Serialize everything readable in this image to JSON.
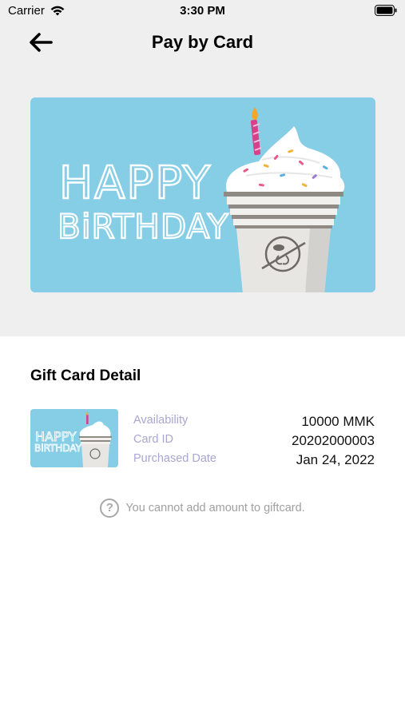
{
  "status_bar": {
    "carrier": "Carrier",
    "time": "3:30 PM"
  },
  "nav": {
    "title": "Pay by Card"
  },
  "card": {
    "line1": "HAPPY",
    "line2": "BiRTHDAY",
    "background": "#86cde6"
  },
  "detail": {
    "title": "Gift Card Detail",
    "rows": [
      {
        "label": "Availability",
        "value": "10000 MMK"
      },
      {
        "label": "Card ID",
        "value": "20202000003"
      },
      {
        "label": "Purchased Date",
        "value": "Jan 24, 2022"
      }
    ]
  },
  "hint": {
    "text": "You cannot add amount to giftcard.",
    "icon": "question-circle-icon"
  },
  "colors": {
    "label": "#a9a6d2",
    "top_bg": "#efefef",
    "accent_candle": "#d6418a"
  }
}
